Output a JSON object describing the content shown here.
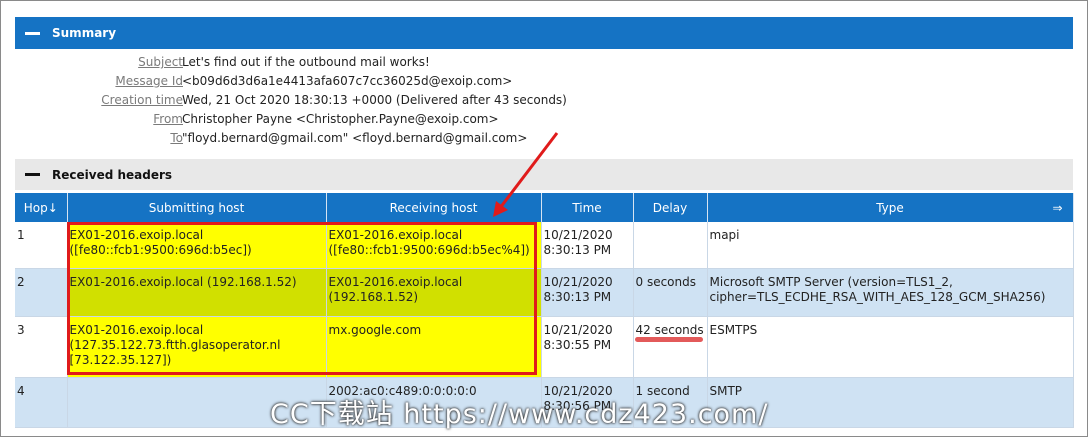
{
  "summary": {
    "title": "Summary",
    "fields": [
      {
        "label": "Subject",
        "value": "Let's find out if the outbound mail works!"
      },
      {
        "label": "Message Id",
        "value": "<b09d6d3d6a1e4413afa607c7cc36025d@exoip.com>"
      },
      {
        "label": "Creation time",
        "value": "Wed, 21 Oct 2020 18:30:13 +0000 (Delivered after 43 seconds)"
      },
      {
        "label": "From",
        "value": "Christopher Payne <Christopher.Payne@exoip.com>"
      },
      {
        "label": "To",
        "value": "\"floyd.bernard@gmail.com\" <floyd.bernard@gmail.com>"
      }
    ]
  },
  "received": {
    "title": "Received headers",
    "columns": [
      "Hop↓",
      "Submitting host",
      "Receiving host",
      "Time",
      "Delay",
      "Type"
    ],
    "expand_glyph": "⇒",
    "rows": [
      {
        "hop": "1",
        "submitting": [
          "EX01-2016.exoip.local",
          "([fe80::fcb1:9500:696d:b5ec])"
        ],
        "receiving": [
          "EX01-2016.exoip.local",
          "([fe80::fcb1:9500:696d:b5ec%4])"
        ],
        "time": [
          "10/21/2020",
          "8:30:13 PM"
        ],
        "delay": "",
        "type": [
          "mapi"
        ]
      },
      {
        "hop": "2",
        "submitting": [
          "EX01-2016.exoip.local (192.168.1.52)"
        ],
        "receiving": [
          "EX01-2016.exoip.local (192.168.1.52)"
        ],
        "time": [
          "10/21/2020",
          "8:30:13 PM"
        ],
        "delay": "0 seconds",
        "type": [
          "Microsoft SMTP Server (version=TLS1_2,",
          "cipher=TLS_ECDHE_RSA_WITH_AES_128_GCM_SHA256)"
        ]
      },
      {
        "hop": "3",
        "submitting": [
          "EX01-2016.exoip.local",
          "(127.35.122.73.ftth.glasoperator.nl",
          "[73.122.35.127])"
        ],
        "receiving": [
          "mx.google.com"
        ],
        "time": [
          "10/21/2020",
          "8:30:55 PM"
        ],
        "delay": "42 seconds",
        "type": [
          "ESMTPS"
        ]
      },
      {
        "hop": "4",
        "submitting": [
          ""
        ],
        "receiving": [
          "2002:ac0:c489:0:0:0:0:0"
        ],
        "time": [
          "10/21/2020",
          "8:30:56 PM"
        ],
        "delay": "1 second",
        "type": [
          "SMTP"
        ]
      }
    ]
  },
  "watermark": "CC下载站 https://www.cdz423.com/",
  "colors": {
    "header_blue": "#1573c4",
    "highlight_yellow": "#ffff00",
    "annotation_red": "#e01b1b"
  }
}
